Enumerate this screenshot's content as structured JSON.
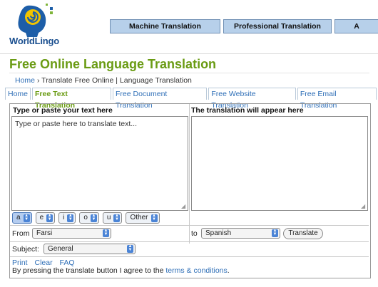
{
  "brand": {
    "name": "WorldLingo"
  },
  "topnav": [
    {
      "label": "Machine Translation"
    },
    {
      "label": "Professional Translation"
    },
    {
      "label": "A"
    }
  ],
  "page_title": "Free Online Language Translation",
  "breadcrumb": {
    "home": "Home",
    "sep": "›",
    "rest": "Translate Free Online | Language Translation"
  },
  "tabs": [
    {
      "label": "Home",
      "active": false
    },
    {
      "label": "Free Text Translation",
      "active": true
    },
    {
      "label": "Free Document Translation",
      "active": false
    },
    {
      "label": "Free Website Translation",
      "active": false
    },
    {
      "label": "Free Email Translation",
      "active": false
    }
  ],
  "source": {
    "heading": "Type or paste your text here",
    "placeholder": "Type or paste here to translate text..."
  },
  "target": {
    "heading": "The translation will appear here"
  },
  "char_buttons": [
    {
      "label": "a",
      "selected": true
    },
    {
      "label": "e",
      "selected": false
    },
    {
      "label": "i",
      "selected": false
    },
    {
      "label": "o",
      "selected": false
    },
    {
      "label": "u",
      "selected": false
    }
  ],
  "other_button": "Other",
  "from": {
    "label": "From",
    "value": "Farsi"
  },
  "to": {
    "label": "to",
    "value": "Spanish"
  },
  "translate_button": "Translate",
  "subject": {
    "label": "Subject:",
    "value": "General"
  },
  "links": {
    "print": "Print",
    "clear": "Clear",
    "faq": "FAQ"
  },
  "notice": {
    "before": "By pressing the translate button I agree to the ",
    "link": "terms & conditions",
    "after": "."
  }
}
